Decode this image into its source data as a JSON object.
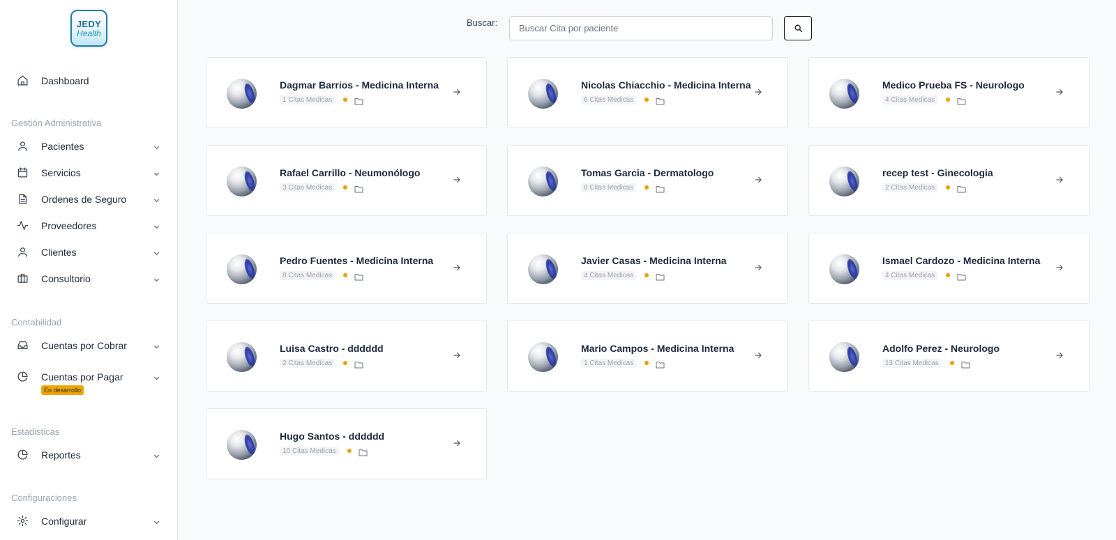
{
  "brand": {
    "line1": "JEDY",
    "line2": "Health"
  },
  "sidebar": {
    "dashboard": {
      "label": "Dashboard",
      "icon": "home-icon"
    },
    "sections": {
      "admin": "Gestión Administrativa",
      "accounting": "Contabilidad",
      "stats": "Estadisticas",
      "config": "Configuraciones"
    },
    "items": [
      {
        "label": "Pacientes",
        "icon": "user-icon"
      },
      {
        "label": "Servicios",
        "icon": "calendar-icon"
      },
      {
        "label": "Ordenes de Seguro",
        "icon": "document-icon"
      },
      {
        "label": "Proveedores",
        "icon": "activity-icon"
      },
      {
        "label": "Clientes",
        "icon": "user-icon"
      },
      {
        "label": "Consultorio",
        "icon": "briefcase-icon"
      },
      {
        "label": "Cuentas por Cobrar",
        "icon": "inbox-icon"
      },
      {
        "label": "Cuentas por Pagar",
        "icon": "pie-chart-icon",
        "badge": "En desarrollo"
      },
      {
        "label": "Reportes",
        "icon": "pie-chart-icon"
      },
      {
        "label": "Configurar",
        "icon": "gear-icon"
      }
    ]
  },
  "search": {
    "label": "Buscar:",
    "placeholder": "Buscar Cita por paciente",
    "value": ""
  },
  "colors": {
    "accent_dot": "#e8a100",
    "badge": "#f0a500",
    "title": "#1e293b"
  },
  "doctors": [
    {
      "title": "Dagmar Barrios - Medicina Interna",
      "count": "1 Citas Medicas"
    },
    {
      "title": "Nicolas Chiacchio - Medicina Interna",
      "count": "6 Citas Medicas"
    },
    {
      "title": "Medico Prueba FS - Neurologo",
      "count": "4 Citas Medicas"
    },
    {
      "title": "Rafael Carrillo - Neumonólogo",
      "count": "3 Citas Medicas"
    },
    {
      "title": "Tomas Garcia - Dermatologo",
      "count": "6 Citas Medicas"
    },
    {
      "title": "recep test - Ginecologia",
      "count": "2 Citas Medicas"
    },
    {
      "title": "Pedro Fuentes - Medicina Interna",
      "count": "8 Citas Medicas"
    },
    {
      "title": "Javier Casas - Medicina Interna",
      "count": "4 Citas Medicas"
    },
    {
      "title": "Ismael Cardozo - Medicina Interna",
      "count": "4 Citas Medicas"
    },
    {
      "title": "Luisa Castro - dddddd",
      "count": "2 Citas Medicas"
    },
    {
      "title": "Mario Campos - Medicina Interna",
      "count": "1 Citas Medicas"
    },
    {
      "title": "Adolfo Perez - Neurologo",
      "count": "13 Citas Medicas"
    },
    {
      "title": "Hugo Santos - dddddd",
      "count": "10 Citas Medicas"
    }
  ]
}
